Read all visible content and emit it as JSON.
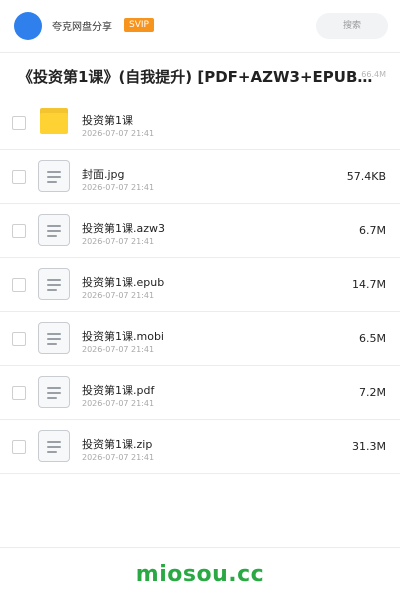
{
  "header": {
    "app_name": "夸克网盘分享",
    "badge": "SVIP",
    "search_label": "搜索"
  },
  "share": {
    "title": "《投资第1课》(自我提升) [PDF+AZW3+EPUB+MO…",
    "total_size": "66.4M"
  },
  "files": [
    {
      "name": "投资第1课",
      "date": "2026-07-07 21:41",
      "size": "",
      "type": "folder",
      "icon": "folder-icon"
    },
    {
      "name": "封面.jpg",
      "date": "2026-07-07 21:41",
      "size": "57.4KB",
      "type": "file",
      "icon": "file-icon"
    },
    {
      "name": "投资第1课.azw3",
      "date": "2026-07-07 21:41",
      "size": "6.7M",
      "type": "file",
      "icon": "file-icon"
    },
    {
      "name": "投资第1课.epub",
      "date": "2026-07-07 21:41",
      "size": "14.7M",
      "type": "file",
      "icon": "file-icon"
    },
    {
      "name": "投资第1课.mobi",
      "date": "2026-07-07 21:41",
      "size": "6.5M",
      "type": "file",
      "icon": "file-icon"
    },
    {
      "name": "投资第1课.pdf",
      "date": "2026-07-07 21:41",
      "size": "7.2M",
      "type": "file",
      "icon": "file-icon"
    },
    {
      "name": "投资第1课.zip",
      "date": "2026-07-07 21:41",
      "size": "31.3M",
      "type": "file",
      "icon": "file-icon"
    }
  ],
  "footer": {
    "watermark": "miosou.cc"
  },
  "colors": {
    "accent": "#2f80ed",
    "badge": "#f7941e",
    "folder": "#ffd233",
    "watermark": "#29a843"
  }
}
